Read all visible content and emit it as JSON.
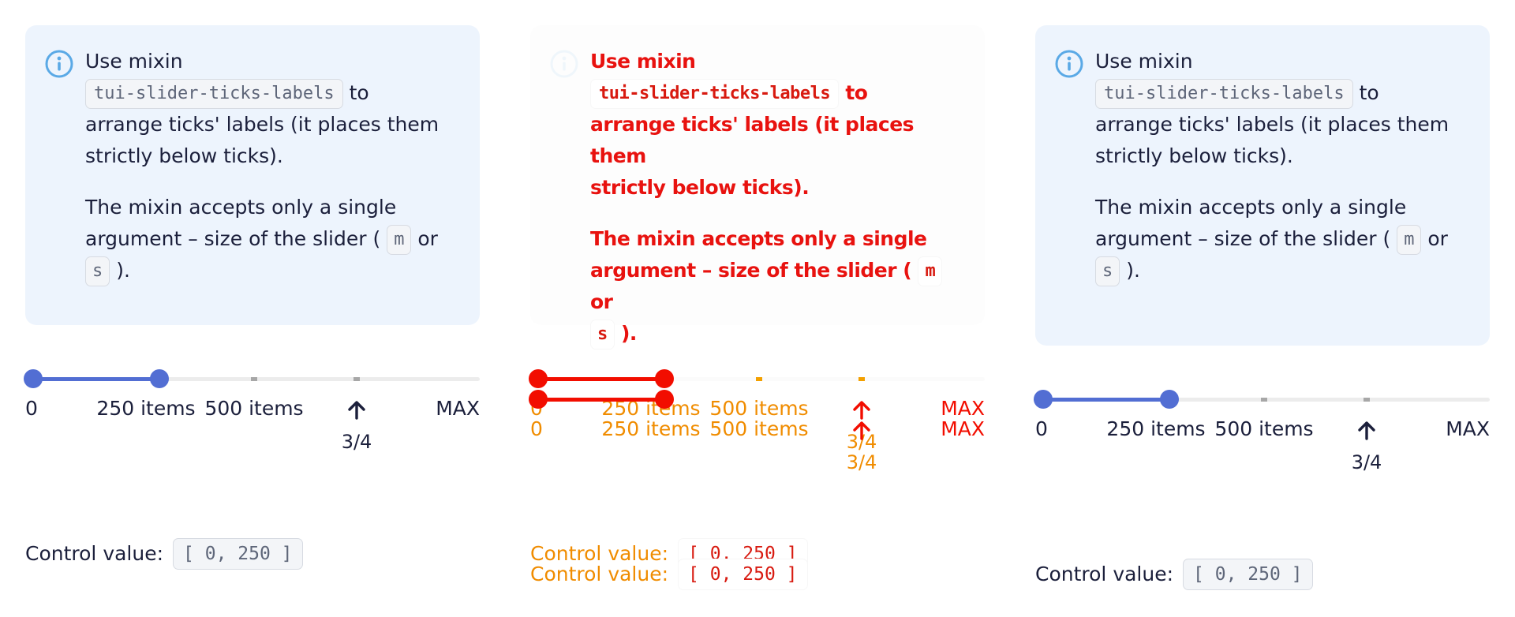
{
  "notice": {
    "line1": "Use mixin",
    "code_mixin": "tui-slider-ticks-labels",
    "line2_after": "to",
    "line3": "arrange ticks' labels (it places them",
    "line4": "strictly below ticks).",
    "p2_line1": "The mixin accepts only a single",
    "p2_line2_before": "argument – size of the slider (",
    "code_m": "m",
    "p2_line2_after": "or",
    "code_s": "s",
    "p2_line3_after": ")."
  },
  "slider": {
    "value": [
      0,
      250
    ],
    "ticks": [
      {
        "label": "0"
      },
      {
        "label": "250 items"
      },
      {
        "label": "500 items"
      },
      {
        "label": "",
        "icon": "arrow-up-icon",
        "sub_label": "3/4"
      },
      {
        "label": "MAX"
      }
    ]
  },
  "control": {
    "label": "Control value:",
    "value": "[ 0, 250 ]"
  },
  "colors": {
    "accent": "#526ed3",
    "notice_bg": "#edf4fd",
    "diff_red": "#f20d00",
    "diff_orange": "#f08c00"
  }
}
